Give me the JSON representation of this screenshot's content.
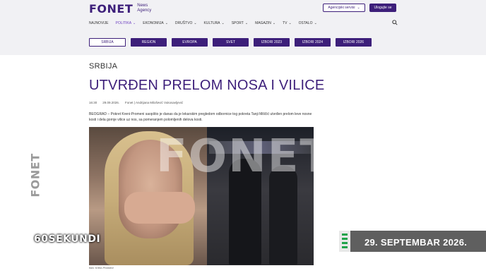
{
  "header": {
    "logo_word": "FONET",
    "logo_sub_1": "News",
    "logo_sub_2": "Agency",
    "agency_select": "Agencijski servisi",
    "login": "Ulogujte se"
  },
  "nav": {
    "items": [
      "NAJNOVIJE",
      "POLITIKA",
      "EKONOMIJA",
      "DRUŠTVO",
      "KULTURA",
      "SPORT",
      "MAGAZIN",
      "TV",
      "OSTALO"
    ]
  },
  "tags": [
    "SRBIJA",
    "REGION",
    "EVROPA",
    "SVET",
    "IZBORI 2023",
    "IZBORI 2024",
    "IZBORI 2026"
  ],
  "article": {
    "section": "SRBIJA",
    "title": "UTVRĐEN PRELOM NOSA I VILICE",
    "time": "16:30",
    "date": "29.09.2026.",
    "author": "Fonet | Andrijana Milošević Vukosavljević",
    "lead": "BEOGRAD – Pokret Kreni-Promeni saopštio je danas da je lekarskim pregledom odbornice tog pokreta Tanji Miščić utvrđen prelom leve nosne kosti i dela gornje vilice uz nos, sa pomeranjem polomljenih delova kosti.",
    "photo_watermark": "FONET",
    "caption": "foto: Kreni-Promeni"
  },
  "overlay": {
    "vertical_logo": "FONET",
    "sekundi": "60SEKUNDI",
    "date_banner": "29. SEPTEMBAR 2026."
  },
  "colors": {
    "brand": "#3d1f7a",
    "banner": "#5f5f5f",
    "banner_accent": "#1fa34a"
  }
}
